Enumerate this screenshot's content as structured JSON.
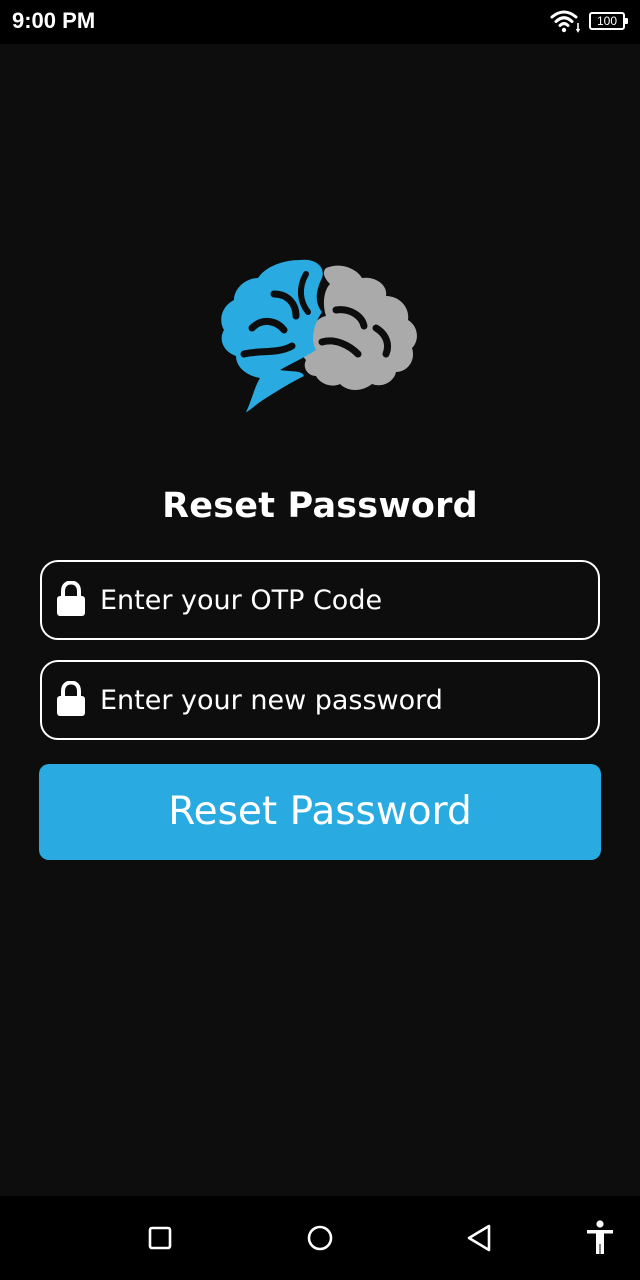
{
  "status_bar": {
    "time": "9:00 PM",
    "wifi_icon": "wifi-icon",
    "battery_level": "100"
  },
  "logo": {
    "icon": "brain-logo-icon",
    "colors": {
      "left_hemisphere": "#29abe2",
      "right_hemisphere": "#aaaaaa"
    }
  },
  "page": {
    "title": "Reset Password"
  },
  "form": {
    "otp_field": {
      "icon": "lock-icon",
      "placeholder": "Enter your OTP Code",
      "value": ""
    },
    "new_password_field": {
      "icon": "lock-icon",
      "placeholder": "Enter your new password",
      "value": ""
    },
    "submit_label": "Reset Password"
  },
  "nav_bar": {
    "items": [
      "recents-icon",
      "home-icon",
      "back-icon",
      "accessibility-icon"
    ]
  },
  "colors": {
    "background": "#0d0d0d",
    "accent": "#29abe2",
    "text": "#ffffff"
  }
}
